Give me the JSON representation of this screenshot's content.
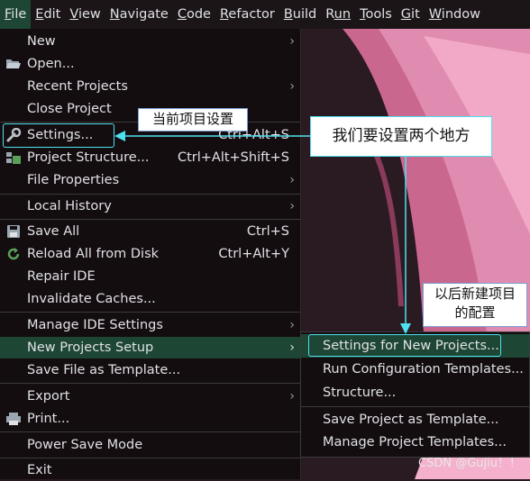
{
  "menubar": {
    "items": [
      {
        "label": "File",
        "mnemonic": "F",
        "rest": "ile",
        "active": true
      },
      {
        "label": "Edit",
        "mnemonic": "E",
        "rest": "dit"
      },
      {
        "label": "View",
        "mnemonic": "V",
        "rest": "iew"
      },
      {
        "label": "Navigate",
        "mnemonic": "N",
        "rest": "avigate"
      },
      {
        "label": "Code",
        "mnemonic": "C",
        "rest": "ode"
      },
      {
        "label": "Refactor",
        "mnemonic": "R",
        "rest": "efactor"
      },
      {
        "label": "Build",
        "mnemonic": "B",
        "rest": "uild"
      },
      {
        "label": "Run",
        "mnemonic": "R",
        "rest": "un",
        "pre": ""
      },
      {
        "label": "Tools",
        "mnemonic": "T",
        "rest": "ools"
      },
      {
        "label": "Git",
        "mnemonic": "G",
        "rest": "it"
      },
      {
        "label": "Window",
        "mnemonic": "W",
        "rest": "indow"
      }
    ]
  },
  "file_menu": {
    "new": "New",
    "open": "Open...",
    "recent_projects": "Recent Projects",
    "close_project": "Close Project",
    "settings": "Settings...",
    "settings_shortcut": "Ctrl+Alt+S",
    "project_structure": "Project Structure...",
    "project_structure_shortcut": "Ctrl+Alt+Shift+S",
    "file_properties": "File Properties",
    "local_history": "Local History",
    "save_all": "Save All",
    "save_all_shortcut": "Ctrl+S",
    "reload_all": "Reload All from Disk",
    "reload_all_shortcut": "Ctrl+Alt+Y",
    "repair_ide": "Repair IDE",
    "invalidate_caches": "Invalidate Caches...",
    "manage_ide_settings": "Manage IDE Settings",
    "new_projects_setup": "New Projects Setup",
    "save_file_as_template": "Save File as Template...",
    "export": "Export",
    "print": "Print...",
    "power_save_mode": "Power Save Mode",
    "exit": "Exit"
  },
  "submenu": {
    "settings_for_new_projects": "Settings for New Projects...",
    "run_configuration_templates": "Run Configuration Templates...",
    "structure": "Structure...",
    "save_project_as_template": "Save Project as Template...",
    "manage_project_templates": "Manage Project Templates..."
  },
  "annotations": {
    "current_project": "当前项目设置",
    "two_places": "我们要设置两个地方",
    "future_projects_line1": "以后新建项目",
    "future_projects_line2": "的配置"
  },
  "watermark": "CSDN @Gujiu！！",
  "colors": {
    "selection": "#1e4634",
    "highlight_box": "#4fe0f0",
    "menu_bg": "#140d10"
  }
}
